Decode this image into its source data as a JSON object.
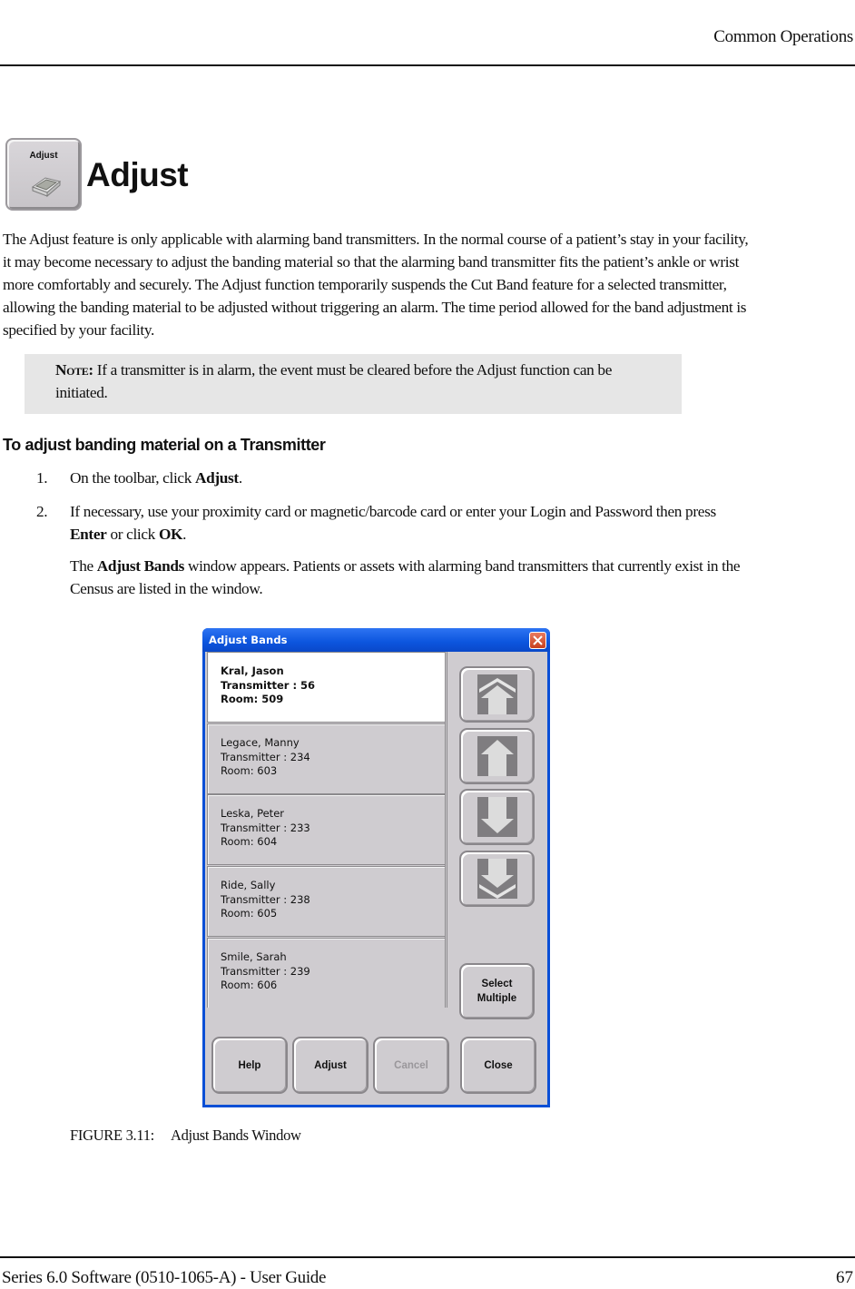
{
  "header": {
    "running_head": "Common Operations"
  },
  "section": {
    "icon_label": "Adjust",
    "icon": "adjust-band-icon",
    "title": "Adjust",
    "paragraph": "The Adjust feature is only applicable with alarming band transmitters. In the normal course of a patient’s stay in your facility, it may become necessary to adjust the banding material so that the alarming band transmitter fits the patient’s ankle or wrist more comfortably and securely. The Adjust function temporarily suspends the Cut Band feature for a selected transmitter, allowing the banding material to be adjusted without triggering an alarm. The time period allowed for the band adjustment is specified by your facility."
  },
  "note": {
    "label": "Note:",
    "text": " If a transmitter is in alarm, the event must be cleared before the Adjust function can be initiated."
  },
  "procedure": {
    "title": "To adjust banding material on a Transmitter",
    "steps": [
      {
        "num": "1.",
        "pre": "On the toolbar, click ",
        "bold": "Adjust",
        "post": "."
      },
      {
        "num": "2.",
        "pre": "If necessary, use your proximity card or magnetic/barcode card or enter your Login and Password then press ",
        "bold": "Enter",
        "mid": " or click ",
        "bold2": "OK",
        "post": "."
      }
    ],
    "result": {
      "pre": "The ",
      "bold": "Adjust Bands",
      "post": " window appears. Patients or assets with alarming band transmitters that currently exist in the Census are listed in the window."
    }
  },
  "window": {
    "title": "Adjust Bands",
    "close_icon": "close-icon",
    "items": [
      {
        "name": "Kral, Jason",
        "transmitter": "Transmitter : 56",
        "room": "Room: 509",
        "selected": true
      },
      {
        "name": "Legace, Manny",
        "transmitter": "Transmitter : 234",
        "room": "Room: 603",
        "selected": false
      },
      {
        "name": "Leska, Peter",
        "transmitter": "Transmitter : 233",
        "room": "Room: 604",
        "selected": false
      },
      {
        "name": "Ride, Sally",
        "transmitter": "Transmitter : 238",
        "room": "Room: 605",
        "selected": false
      },
      {
        "name": "Smile, Sarah",
        "transmitter": "Transmitter : 239",
        "room": "Room: 606",
        "selected": false
      }
    ],
    "nav_buttons": [
      "page-up-icon",
      "scroll-up-icon",
      "scroll-down-icon",
      "page-down-icon"
    ],
    "select_multiple": "Select Multiple",
    "buttons": {
      "help": "Help",
      "adjust": "Adjust",
      "cancel": "Cancel",
      "close": "Close"
    },
    "colors": {
      "titlebar": "#0c55de",
      "client": "#cfccd0",
      "selected_row": "#ffffff"
    }
  },
  "figure": {
    "number": "FIGURE 3.11:",
    "caption": "Adjust Bands Window"
  },
  "footer": {
    "left": "Series 6.0 Software (0510-1065-A) - User Guide",
    "page": "67"
  }
}
